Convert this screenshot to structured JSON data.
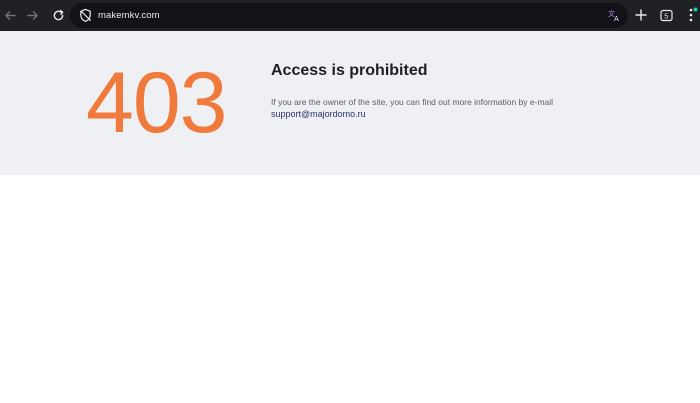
{
  "browser": {
    "url": "makemkv.com",
    "accent_color": "#20c5b3"
  },
  "error_page": {
    "code": "403",
    "title": "Access is prohibited",
    "description": "If you are the owner of the site, you can find out more information by e-mail",
    "email": "support@majordomo.ru",
    "code_color": "#f07a3c"
  }
}
